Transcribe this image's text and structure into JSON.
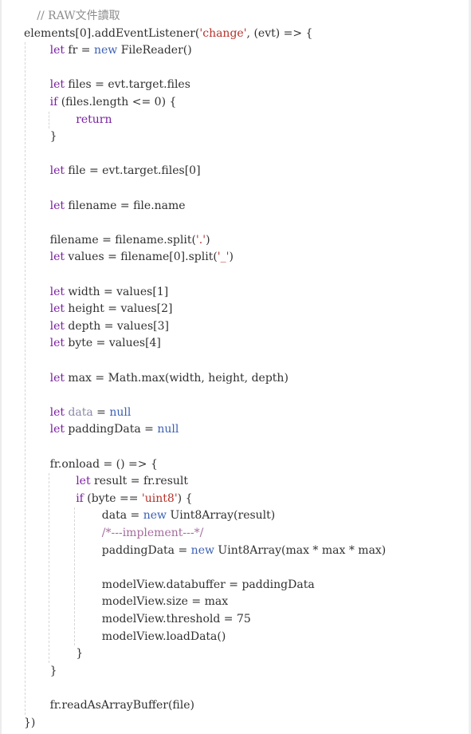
{
  "editor": {
    "lines": [
      {
        "indent": 1,
        "tokens": [
          {
            "t": "// RAW文件讀取",
            "c": "com"
          }
        ]
      },
      {
        "indent": 0,
        "tokens": [
          {
            "t": "elements[0].addEventListener(",
            "c": "txt"
          },
          {
            "t": "'change'",
            "c": "str"
          },
          {
            "t": ", (evt) => {",
            "c": "txt"
          }
        ]
      },
      {
        "indent": 2,
        "tokens": [
          {
            "t": "let",
            "c": "kw"
          },
          {
            "t": " fr = ",
            "c": "txt"
          },
          {
            "t": "new",
            "c": "kw2"
          },
          {
            "t": " FileReader()",
            "c": "txt"
          }
        ]
      },
      {
        "indent": 2,
        "tokens": []
      },
      {
        "indent": 2,
        "tokens": [
          {
            "t": "let",
            "c": "kw"
          },
          {
            "t": " files = evt.target.files",
            "c": "txt"
          }
        ]
      },
      {
        "indent": 2,
        "tokens": [
          {
            "t": "if",
            "c": "kw"
          },
          {
            "t": " (files.length <= 0) {",
            "c": "txt"
          }
        ]
      },
      {
        "indent": 4,
        "tokens": [
          {
            "t": "return",
            "c": "kw"
          }
        ]
      },
      {
        "indent": 2,
        "tokens": [
          {
            "t": "}",
            "c": "txt"
          }
        ]
      },
      {
        "indent": 2,
        "tokens": []
      },
      {
        "indent": 2,
        "tokens": [
          {
            "t": "let",
            "c": "kw"
          },
          {
            "t": " file = evt.target.files[0]",
            "c": "txt"
          }
        ]
      },
      {
        "indent": 2,
        "tokens": []
      },
      {
        "indent": 2,
        "tokens": [
          {
            "t": "let",
            "c": "kw"
          },
          {
            "t": " filename = file.name",
            "c": "txt"
          }
        ]
      },
      {
        "indent": 2,
        "tokens": []
      },
      {
        "indent": 2,
        "tokens": [
          {
            "t": "filename = filename.split(",
            "c": "txt"
          },
          {
            "t": "'.'",
            "c": "str"
          },
          {
            "t": ")",
            "c": "txt"
          }
        ]
      },
      {
        "indent": 2,
        "tokens": [
          {
            "t": "let",
            "c": "kw"
          },
          {
            "t": " values = filename[0].split(",
            "c": "txt"
          },
          {
            "t": "'_'",
            "c": "str"
          },
          {
            "t": ")",
            "c": "txt"
          }
        ]
      },
      {
        "indent": 2,
        "tokens": []
      },
      {
        "indent": 2,
        "tokens": [
          {
            "t": "let",
            "c": "kw"
          },
          {
            "t": " width = values[1]",
            "c": "txt"
          }
        ]
      },
      {
        "indent": 2,
        "tokens": [
          {
            "t": "let",
            "c": "kw"
          },
          {
            "t": " height = values[2]",
            "c": "txt"
          }
        ]
      },
      {
        "indent": 2,
        "tokens": [
          {
            "t": "let",
            "c": "kw"
          },
          {
            "t": " depth = values[3]",
            "c": "txt"
          }
        ]
      },
      {
        "indent": 2,
        "tokens": [
          {
            "t": "let",
            "c": "kw"
          },
          {
            "t": " byte = values[4]",
            "c": "txt"
          }
        ]
      },
      {
        "indent": 2,
        "tokens": []
      },
      {
        "indent": 2,
        "tokens": [
          {
            "t": "let",
            "c": "kw"
          },
          {
            "t": " max = Math.max(width, height, depth)",
            "c": "txt"
          }
        ]
      },
      {
        "indent": 2,
        "tokens": []
      },
      {
        "indent": 2,
        "tokens": [
          {
            "t": "let",
            "c": "kw"
          },
          {
            "t": " ",
            "c": "txt"
          },
          {
            "t": "data",
            "c": "var"
          },
          {
            "t": " = ",
            "c": "txt"
          },
          {
            "t": "null",
            "c": "kw2"
          }
        ]
      },
      {
        "indent": 2,
        "tokens": [
          {
            "t": "let",
            "c": "kw"
          },
          {
            "t": " paddingData = ",
            "c": "txt"
          },
          {
            "t": "null",
            "c": "kw2"
          }
        ]
      },
      {
        "indent": 2,
        "tokens": []
      },
      {
        "indent": 2,
        "tokens": [
          {
            "t": "fr.onload = () => {",
            "c": "txt"
          }
        ]
      },
      {
        "indent": 4,
        "tokens": [
          {
            "t": "let",
            "c": "kw"
          },
          {
            "t": " result = fr.result",
            "c": "txt"
          }
        ]
      },
      {
        "indent": 4,
        "tokens": [
          {
            "t": "if",
            "c": "kw"
          },
          {
            "t": " (byte == ",
            "c": "txt"
          },
          {
            "t": "'uint8'",
            "c": "str"
          },
          {
            "t": ") {",
            "c": "txt"
          }
        ]
      },
      {
        "indent": 6,
        "tokens": [
          {
            "t": "data = ",
            "c": "txt"
          },
          {
            "t": "new",
            "c": "kw2"
          },
          {
            "t": " Uint8Array(result)",
            "c": "txt"
          }
        ]
      },
      {
        "indent": 6,
        "tokens": [
          {
            "t": "/*---implement---*/",
            "c": "com2"
          }
        ]
      },
      {
        "indent": 6,
        "tokens": [
          {
            "t": "paddingData = ",
            "c": "txt"
          },
          {
            "t": "new",
            "c": "kw2"
          },
          {
            "t": " Uint8Array(max * max * max)",
            "c": "txt"
          }
        ]
      },
      {
        "indent": 6,
        "tokens": []
      },
      {
        "indent": 6,
        "tokens": [
          {
            "t": "modelView.databuffer = paddingData",
            "c": "txt"
          }
        ]
      },
      {
        "indent": 6,
        "tokens": [
          {
            "t": "modelView.size = max",
            "c": "txt"
          }
        ]
      },
      {
        "indent": 6,
        "tokens": [
          {
            "t": "modelView.threshold = 75",
            "c": "txt"
          }
        ]
      },
      {
        "indent": 6,
        "tokens": [
          {
            "t": "modelView.loadData()",
            "c": "txt"
          }
        ]
      },
      {
        "indent": 4,
        "tokens": [
          {
            "t": "}",
            "c": "txt"
          }
        ]
      },
      {
        "indent": 2,
        "tokens": [
          {
            "t": "}",
            "c": "txt"
          }
        ]
      },
      {
        "indent": 2,
        "tokens": []
      },
      {
        "indent": 2,
        "tokens": [
          {
            "t": "fr.readAsArrayBuffer(file)",
            "c": "txt"
          }
        ]
      },
      {
        "indent": 0,
        "tokens": [
          {
            "t": "})",
            "c": "txt"
          }
        ]
      }
    ]
  }
}
